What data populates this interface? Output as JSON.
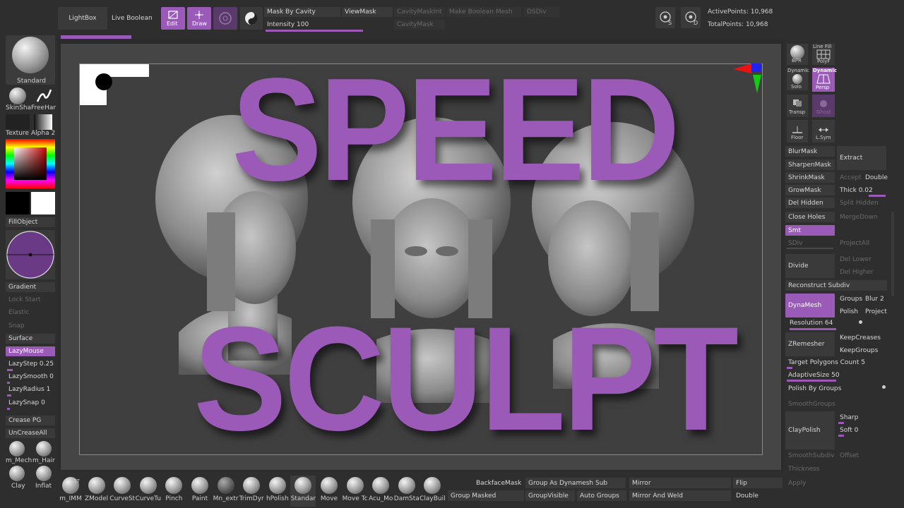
{
  "top": {
    "lightbox": "LightBox",
    "live_boolean": "Live Boolean",
    "edit": "Edit",
    "draw": "Draw",
    "mask_by_cavity": "Mask By Cavity",
    "view_mask": "ViewMask",
    "cavity_mask_int": "CavityMaskInt",
    "make_boolean_mesh": "Make Boolean Mesh",
    "dsdiv": "DSDiv",
    "intensity": "Intensity 100",
    "cavity_mask": "CavityMask",
    "s_label": "S",
    "d_label": "D",
    "active_points": "ActivePoints: 10,968",
    "total_points": "TotalPoints: 10,968"
  },
  "left": {
    "standard": "Standard",
    "skinshade": "SkinSha",
    "freehand": "FreeHar",
    "texture": "Texture",
    "alpha": "Alpha 2",
    "fill_object": "FillObject",
    "gradient": "Gradient",
    "lock_start": "Lock Start",
    "elastic": "Elastic",
    "snap": "Snap",
    "surface": "Surface",
    "lazy_mouse": "LazyMouse",
    "lazy_step": "LazyStep 0.25",
    "lazy_smooth": "LazySmooth 0",
    "lazy_radius": "LazyRadius 1",
    "lazy_snap": "LazySnap 0",
    "crease_pg": "Crease PG",
    "uncrease_all": "UnCreaseAll",
    "brush1": "m_Mech",
    "brush2": "m_Hair",
    "brush3": "Clay",
    "brush4": "Inflat"
  },
  "title": {
    "line1": "SPEED",
    "line2": "SCULPT"
  },
  "right": {
    "bpr": "BPR",
    "line_fill": "Line Fill",
    "polyf": "PolyF",
    "dynamic1": "Dynamic",
    "solo": "Solo",
    "dynamic2": "Dynamic",
    "persp": "Persp",
    "transp": "Transp",
    "ghost": "Ghost",
    "floor": "Floor",
    "lsym": "L.Sym",
    "blur_mask": "BlurMask",
    "sharpen_mask": "SharpenMask",
    "shrink_mask": "ShrinkMask",
    "grow_mask": "GrowMask",
    "del_hidden": "Del Hidden",
    "close_holes": "Close Holes",
    "smt": "Smt",
    "sdiv": "SDiv",
    "divide": "Divide",
    "reconstruct_subdiv": "Reconstruct Subdiv",
    "extract": "Extract",
    "accept": "Accept",
    "double": "Double",
    "thick": "Thick 0.02",
    "split_hidden": "Split Hidden",
    "merge_down": "MergeDown",
    "project_all": "ProjectAll",
    "del_lower": "Del Lower",
    "del_higher": "Del Higher",
    "dynamesh": "DynaMesh",
    "groups": "Groups",
    "blur": "Blur 2",
    "polish": "Polish",
    "project": "Project",
    "resolution": "Resolution 64",
    "zremesher": "ZRemesher",
    "keep_creases": "KeepCreases",
    "keep_groups": "KeepGroups",
    "target_polygons": "Target Polygons Count 5",
    "adaptive_size": "AdaptiveSize 50",
    "polish_by_groups": "Polish By Groups",
    "smooth_groups": "SmoothGroups",
    "clay_polish": "ClayPolish",
    "sharp": "Sharp",
    "soft": "Soft 0",
    "smooth_subdiv": "SmoothSubdiv",
    "offset": "Offset",
    "thickness": "Thickness",
    "apply": "Apply"
  },
  "bottom": {
    "count": "17",
    "brushes": [
      "m_IMM",
      "ZModel",
      "CurveSt",
      "CurveTu",
      "Pinch",
      "Paint",
      "Mn_extr",
      "TrimDyr",
      "hPolish",
      "Standar",
      "Move",
      "Move Tc",
      "Acu_Mo",
      "DamSta",
      "ClayBuil"
    ],
    "backface_mask": "BackfaceMask",
    "group_as_dynamesh": "Group As Dynamesh Sub",
    "mirror": "Mirror",
    "flip": "Flip",
    "group_masked": "Group Masked",
    "group_visible": "GroupVisible",
    "auto_groups": "Auto Groups",
    "mirror_and_weld": "Mirror And Weld",
    "double": "Double"
  }
}
